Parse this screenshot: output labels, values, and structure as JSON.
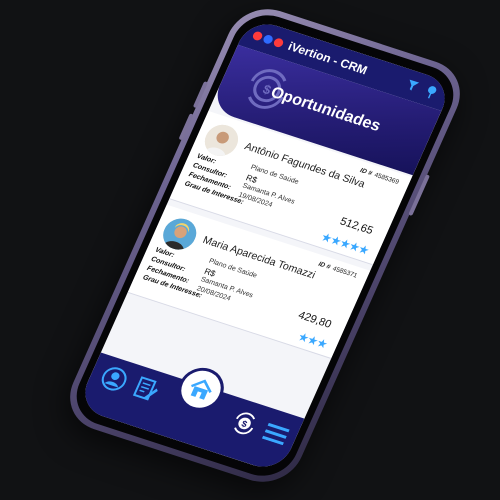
{
  "header": {
    "app_title": "iVertion - CRM"
  },
  "banner": {
    "title": "Oportunidades"
  },
  "cards": [
    {
      "id_label": "ID #",
      "id_value": "4585369",
      "name": "Antônio Fagundes da Silva",
      "valor_label": "Valor:",
      "product": "Plano de Saúde",
      "currency": "R$",
      "consultor_label": "Consultor:",
      "consultor": "Samanta P. Alves",
      "fechamento_label": "Fechamento:",
      "fechamento": "19/08/2024",
      "interesse_label": "Grau de Interesse:",
      "amount": "512,65",
      "stars": "★★★★★",
      "interest_level": 5
    },
    {
      "id_label": "ID #",
      "id_value": "4585371",
      "name": "Maria Aparecida Tomazzi",
      "valor_label": "Valor:",
      "product": "Plano de Saúde",
      "currency": "R$",
      "consultor_label": "Consultor:",
      "consultor": "Samanta P. Alves",
      "fechamento_label": "Fechamento:",
      "fechamento": "20/08/2024",
      "interesse_label": "Grau de Interesse:",
      "amount": "429,80",
      "stars": "★★★",
      "interest_level": 3
    }
  ],
  "icons": {
    "filter": "filter-icon",
    "pin": "pin-icon",
    "profile": "user-icon",
    "contracts": "document-edit-icon",
    "home": "home-icon",
    "money": "money-cycle-icon",
    "menu": "hamburger-menu-icon"
  },
  "colors": {
    "primary": "#1a1b6e",
    "banner": "#241c73",
    "accent": "#3aa8ff",
    "card_bg": "#ffffff"
  }
}
